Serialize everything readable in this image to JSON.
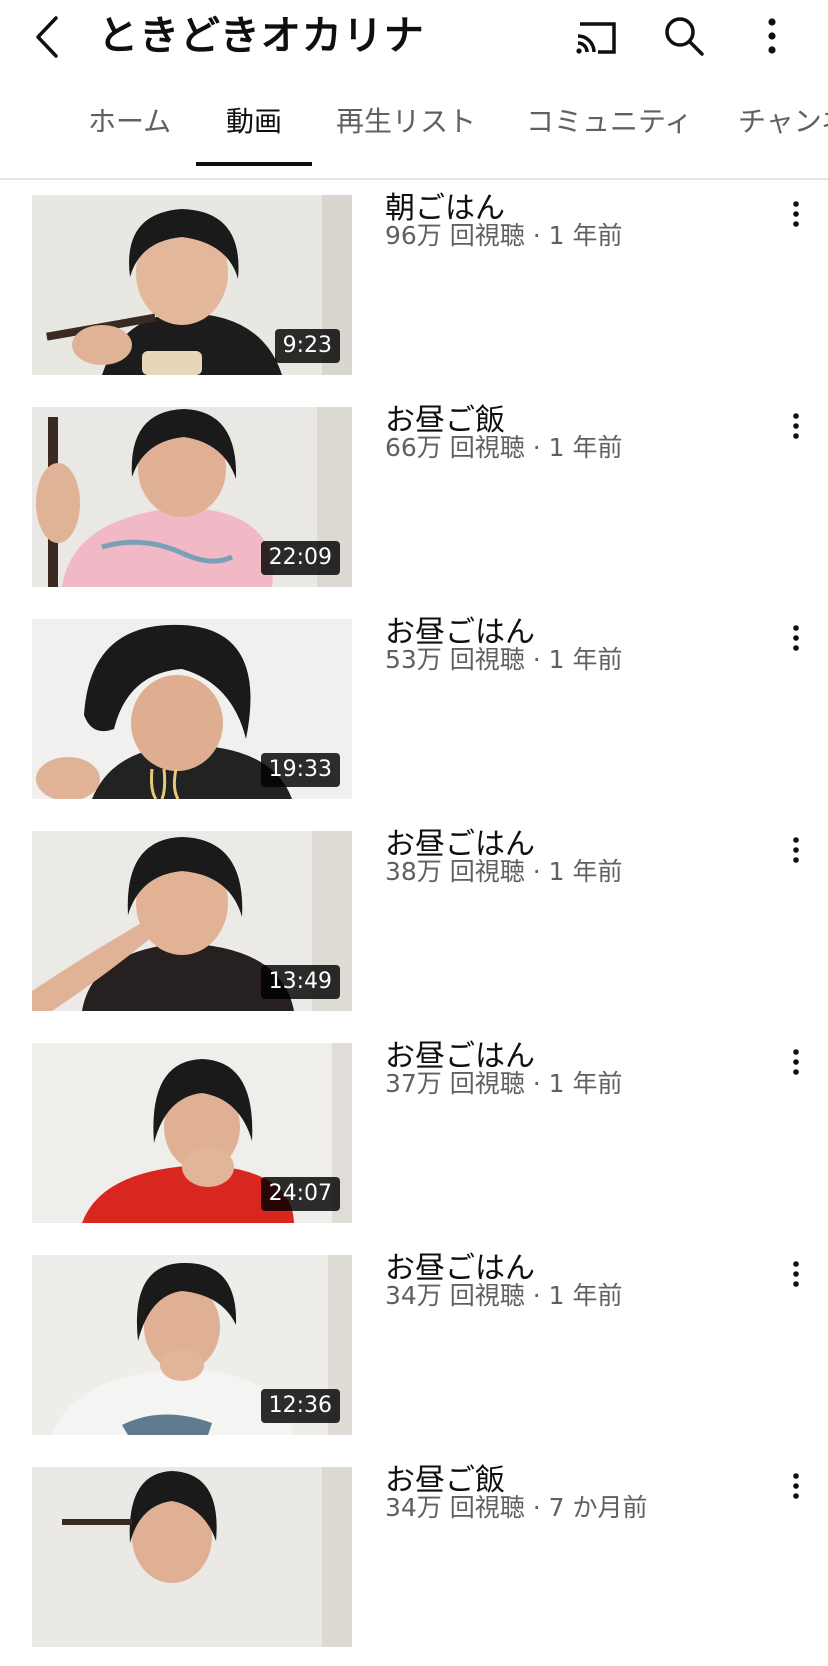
{
  "header": {
    "title": "ときどきオカリナ",
    "back_icon": "back-chevron-icon",
    "cast_icon": "cast-icon",
    "search_icon": "search-icon",
    "more_icon": "more-vertical-icon"
  },
  "tabs": [
    {
      "label": "ホーム",
      "active": false
    },
    {
      "label": "動画",
      "active": true
    },
    {
      "label": "再生リスト",
      "active": false
    },
    {
      "label": "コミュニティ",
      "active": false
    },
    {
      "label": "チャンネル",
      "active": false
    }
  ],
  "videos": [
    {
      "title": "朝ごはん",
      "meta": "96万 回視聴 · 1 年前",
      "duration": "9:23"
    },
    {
      "title": "お昼ご飯",
      "meta": "66万 回視聴 · 1 年前",
      "duration": "22:09"
    },
    {
      "title": "お昼ごはん",
      "meta": "53万 回視聴 · 1 年前",
      "duration": "19:33"
    },
    {
      "title": "お昼ごはん",
      "meta": "38万 回視聴 · 1 年前",
      "duration": "13:49"
    },
    {
      "title": "お昼ごはん",
      "meta": "37万 回視聴 · 1 年前",
      "duration": "24:07"
    },
    {
      "title": "お昼ごはん",
      "meta": "34万 回視聴 · 1 年前",
      "duration": "12:36"
    },
    {
      "title": "お昼ご飯",
      "meta": "34万 回視聴 · 7 か月前",
      "duration": ""
    }
  ],
  "colors": {
    "text": "#0f0f0f",
    "secondary": "#606060",
    "divider": "#e5e5e5"
  }
}
